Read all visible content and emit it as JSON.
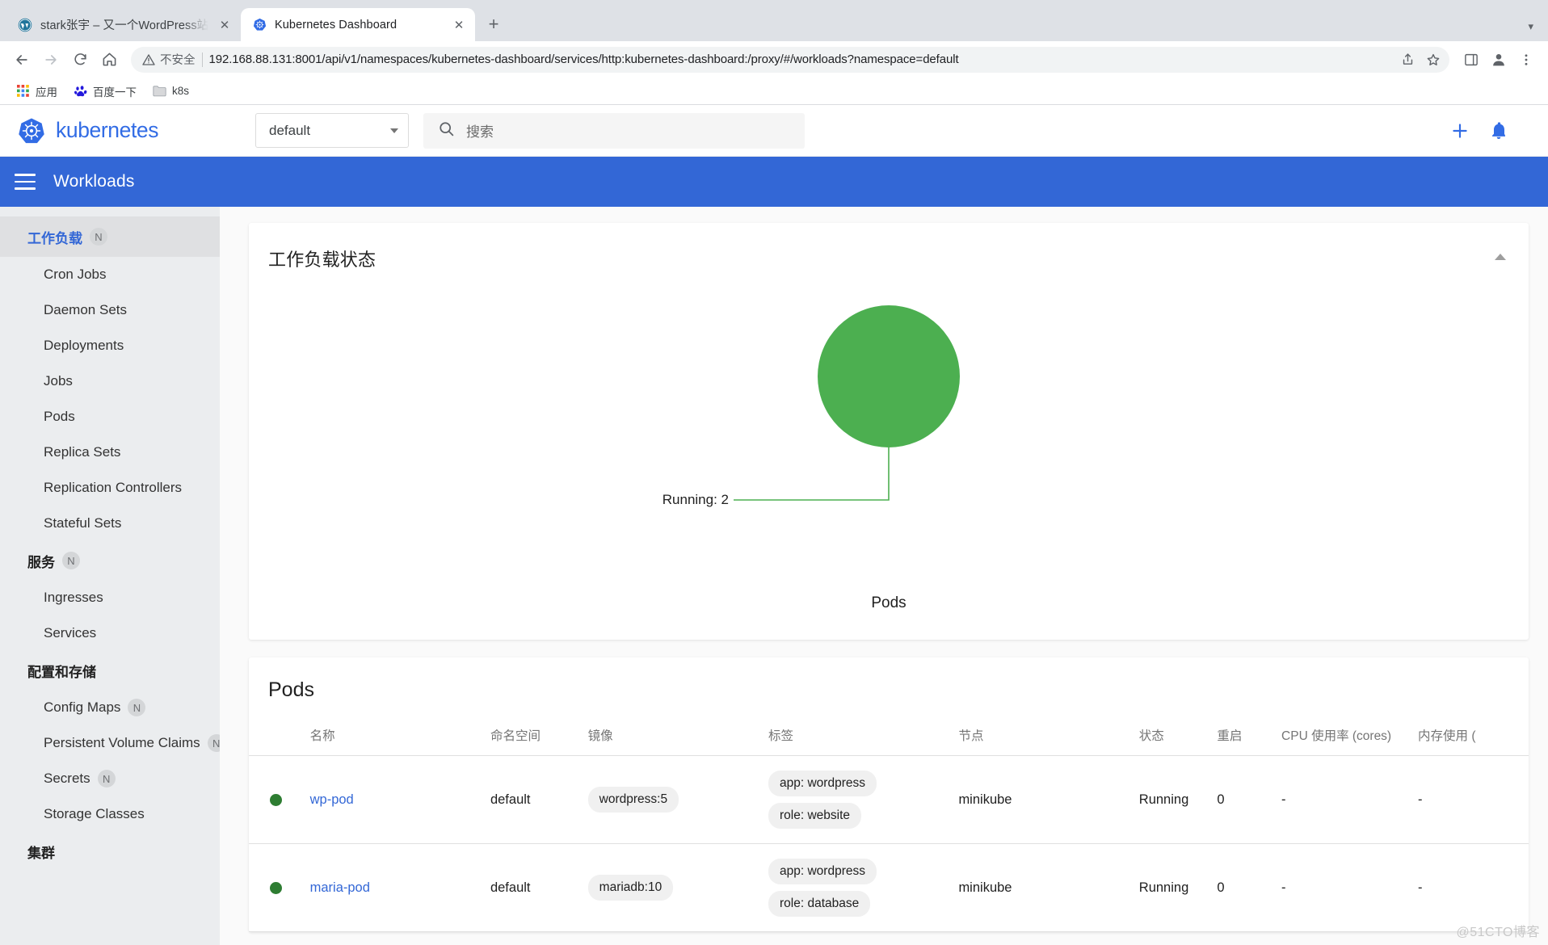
{
  "browser": {
    "tabs": [
      {
        "title": "stark张宇 – 又一个WordPress站",
        "favicon": "wordpress-icon",
        "active": false
      },
      {
        "title": "Kubernetes Dashboard",
        "favicon": "kubernetes-icon",
        "active": true
      }
    ],
    "new_tab_label": "+",
    "tab_close_label": "✕",
    "tab_list_caret": "▾",
    "nav": {
      "back": "←",
      "forward": "→",
      "reload": "⟳",
      "home": "⌂"
    },
    "omnibox": {
      "security_label": "不安全",
      "security_icon": "warning-triangle-icon",
      "url": "192.168.88.131:8001/api/v1/namespaces/kubernetes-dashboard/services/http:kubernetes-dashboard:/proxy/#/workloads?namespace=default",
      "share_icon": "share-icon",
      "bookmark_icon": "star-icon",
      "sidepanel_icon": "side-panel-icon",
      "profile_icon": "profile-avatar-icon",
      "menu_icon": "three-dot-menu-icon"
    },
    "bookmarks": [
      {
        "label": "应用",
        "icon": "apps-grid-icon"
      },
      {
        "label": "百度一下",
        "icon": "baidu-icon"
      },
      {
        "label": "k8s",
        "icon": "folder-icon"
      }
    ]
  },
  "app": {
    "brand": "kubernetes",
    "brand_color": "#326ce5",
    "namespace_selector": {
      "value": "default",
      "caret": "▾"
    },
    "search": {
      "placeholder": "搜索",
      "icon": "search-icon"
    },
    "header_actions": [
      {
        "name": "create-button",
        "glyph": "+"
      },
      {
        "name": "notifications-button",
        "glyph": "bell"
      }
    ],
    "page_title": "Workloads",
    "menu_icon": "hamburger-menu-icon"
  },
  "sidebar": {
    "items": [
      {
        "label": "工作负载",
        "badge": "N",
        "active": true,
        "section": false
      },
      {
        "label": "Cron Jobs",
        "badge": "",
        "active": false,
        "section": false
      },
      {
        "label": "Daemon Sets",
        "badge": "",
        "active": false,
        "section": false
      },
      {
        "label": "Deployments",
        "badge": "",
        "active": false,
        "section": false
      },
      {
        "label": "Jobs",
        "badge": "",
        "active": false,
        "section": false
      },
      {
        "label": "Pods",
        "badge": "",
        "active": false,
        "section": false
      },
      {
        "label": "Replica Sets",
        "badge": "",
        "active": false,
        "section": false
      },
      {
        "label": "Replication Controllers",
        "badge": "",
        "active": false,
        "section": false
      },
      {
        "label": "Stateful Sets",
        "badge": "",
        "active": false,
        "section": false
      },
      {
        "label": "服务",
        "badge": "N",
        "active": false,
        "section": true
      },
      {
        "label": "Ingresses",
        "badge": "",
        "active": false,
        "section": false
      },
      {
        "label": "Services",
        "badge": "",
        "active": false,
        "section": false
      },
      {
        "label": "配置和存储",
        "badge": "",
        "active": false,
        "section": true
      },
      {
        "label": "Config Maps",
        "badge": "N",
        "active": false,
        "section": false
      },
      {
        "label": "Persistent Volume Claims",
        "badge": "N",
        "active": false,
        "section": false
      },
      {
        "label": "Secrets",
        "badge": "N",
        "active": false,
        "section": false
      },
      {
        "label": "Storage Classes",
        "badge": "",
        "active": false,
        "section": false
      },
      {
        "label": "集群",
        "badge": "",
        "active": false,
        "section": true
      }
    ]
  },
  "workload_status_card": {
    "title": "工作负载状态",
    "collapse_icon": "chevron-up-icon"
  },
  "chart_data": {
    "type": "pie",
    "title": "工作负载状态",
    "caption": "Pods",
    "categories": [
      "Running"
    ],
    "values": [
      2
    ],
    "colors": [
      "#4caf50"
    ],
    "annotations": [
      "Running: 2"
    ],
    "legend": "none",
    "grid": false,
    "xlabel": "",
    "ylabel": ""
  },
  "pods_card": {
    "title": "Pods",
    "columns": [
      {
        "key": "dot",
        "label": ""
      },
      {
        "key": "name",
        "label": "名称"
      },
      {
        "key": "namespace",
        "label": "命名空间"
      },
      {
        "key": "image",
        "label": "镜像"
      },
      {
        "key": "labels",
        "label": "标签"
      },
      {
        "key": "node",
        "label": "节点"
      },
      {
        "key": "status",
        "label": "状态"
      },
      {
        "key": "restarts",
        "label": "重启"
      },
      {
        "key": "cpu",
        "label": "CPU 使用率 (cores)"
      },
      {
        "key": "memory",
        "label": "内存使用 ("
      }
    ],
    "rows": [
      {
        "status_color": "#2e7d32",
        "name": "wp-pod",
        "namespace": "default",
        "image": "wordpress:5",
        "labels": [
          "app: wordpress",
          "role: website"
        ],
        "node": "minikube",
        "status": "Running",
        "restarts": "0",
        "cpu": "-",
        "memory": "-"
      },
      {
        "status_color": "#2e7d32",
        "name": "maria-pod",
        "namespace": "default",
        "image": "mariadb:10",
        "labels": [
          "app: wordpress",
          "role: database"
        ],
        "node": "minikube",
        "status": "Running",
        "restarts": "0",
        "cpu": "-",
        "memory": "-"
      }
    ]
  },
  "watermark": "@51CTO博客"
}
